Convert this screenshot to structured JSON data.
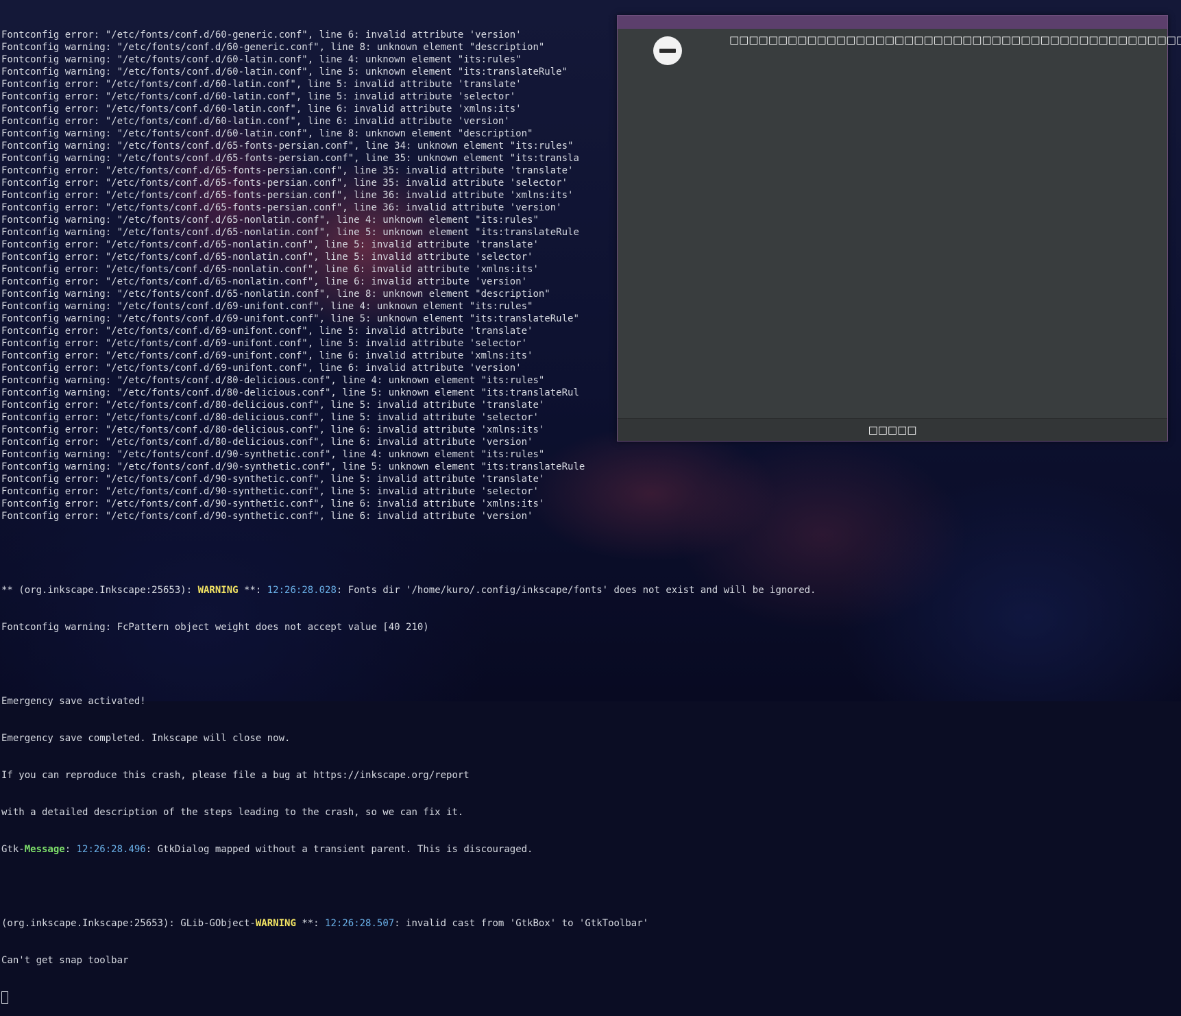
{
  "terminal": {
    "lines": [
      "Fontconfig error: \"/etc/fonts/conf.d/60-generic.conf\", line 6: invalid attribute 'version'",
      "Fontconfig warning: \"/etc/fonts/conf.d/60-generic.conf\", line 8: unknown element \"description\"",
      "Fontconfig warning: \"/etc/fonts/conf.d/60-latin.conf\", line 4: unknown element \"its:rules\"",
      "Fontconfig warning: \"/etc/fonts/conf.d/60-latin.conf\", line 5: unknown element \"its:translateRule\"",
      "Fontconfig error: \"/etc/fonts/conf.d/60-latin.conf\", line 5: invalid attribute 'translate'",
      "Fontconfig error: \"/etc/fonts/conf.d/60-latin.conf\", line 5: invalid attribute 'selector'",
      "Fontconfig error: \"/etc/fonts/conf.d/60-latin.conf\", line 6: invalid attribute 'xmlns:its'",
      "Fontconfig error: \"/etc/fonts/conf.d/60-latin.conf\", line 6: invalid attribute 'version'",
      "Fontconfig warning: \"/etc/fonts/conf.d/60-latin.conf\", line 8: unknown element \"description\"",
      "Fontconfig warning: \"/etc/fonts/conf.d/65-fonts-persian.conf\", line 34: unknown element \"its:rules\"",
      "Fontconfig warning: \"/etc/fonts/conf.d/65-fonts-persian.conf\", line 35: unknown element \"its:transla",
      "Fontconfig error: \"/etc/fonts/conf.d/65-fonts-persian.conf\", line 35: invalid attribute 'translate'",
      "Fontconfig error: \"/etc/fonts/conf.d/65-fonts-persian.conf\", line 35: invalid attribute 'selector'",
      "Fontconfig error: \"/etc/fonts/conf.d/65-fonts-persian.conf\", line 36: invalid attribute 'xmlns:its'",
      "Fontconfig error: \"/etc/fonts/conf.d/65-fonts-persian.conf\", line 36: invalid attribute 'version'",
      "Fontconfig warning: \"/etc/fonts/conf.d/65-nonlatin.conf\", line 4: unknown element \"its:rules\"",
      "Fontconfig warning: \"/etc/fonts/conf.d/65-nonlatin.conf\", line 5: unknown element \"its:translateRule",
      "Fontconfig error: \"/etc/fonts/conf.d/65-nonlatin.conf\", line 5: invalid attribute 'translate'",
      "Fontconfig error: \"/etc/fonts/conf.d/65-nonlatin.conf\", line 5: invalid attribute 'selector'",
      "Fontconfig error: \"/etc/fonts/conf.d/65-nonlatin.conf\", line 6: invalid attribute 'xmlns:its'",
      "Fontconfig error: \"/etc/fonts/conf.d/65-nonlatin.conf\", line 6: invalid attribute 'version'",
      "Fontconfig warning: \"/etc/fonts/conf.d/65-nonlatin.conf\", line 8: unknown element \"description\"",
      "Fontconfig warning: \"/etc/fonts/conf.d/69-unifont.conf\", line 4: unknown element \"its:rules\"",
      "Fontconfig warning: \"/etc/fonts/conf.d/69-unifont.conf\", line 5: unknown element \"its:translateRule\"",
      "Fontconfig error: \"/etc/fonts/conf.d/69-unifont.conf\", line 5: invalid attribute 'translate'",
      "Fontconfig error: \"/etc/fonts/conf.d/69-unifont.conf\", line 5: invalid attribute 'selector'",
      "Fontconfig error: \"/etc/fonts/conf.d/69-unifont.conf\", line 6: invalid attribute 'xmlns:its'",
      "Fontconfig error: \"/etc/fonts/conf.d/69-unifont.conf\", line 6: invalid attribute 'version'",
      "Fontconfig warning: \"/etc/fonts/conf.d/80-delicious.conf\", line 4: unknown element \"its:rules\"",
      "Fontconfig warning: \"/etc/fonts/conf.d/80-delicious.conf\", line 5: unknown element \"its:translateRul",
      "Fontconfig error: \"/etc/fonts/conf.d/80-delicious.conf\", line 5: invalid attribute 'translate'",
      "Fontconfig error: \"/etc/fonts/conf.d/80-delicious.conf\", line 5: invalid attribute 'selector'",
      "Fontconfig error: \"/etc/fonts/conf.d/80-delicious.conf\", line 6: invalid attribute 'xmlns:its'",
      "Fontconfig error: \"/etc/fonts/conf.d/80-delicious.conf\", line 6: invalid attribute 'version'",
      "Fontconfig warning: \"/etc/fonts/conf.d/90-synthetic.conf\", line 4: unknown element \"its:rules\"",
      "Fontconfig warning: \"/etc/fonts/conf.d/90-synthetic.conf\", line 5: unknown element \"its:translateRule",
      "Fontconfig error: \"/etc/fonts/conf.d/90-synthetic.conf\", line 5: invalid attribute 'translate'",
      "Fontconfig error: \"/etc/fonts/conf.d/90-synthetic.conf\", line 5: invalid attribute 'selector'",
      "Fontconfig error: \"/etc/fonts/conf.d/90-synthetic.conf\", line 6: invalid attribute 'xmlns:its'",
      "Fontconfig error: \"/etc/fonts/conf.d/90-synthetic.conf\", line 6: invalid attribute 'version'"
    ],
    "inkscape_warning": {
      "prefix": "** (org.inkscape.Inkscape:25653): ",
      "level": "WARNING",
      "mid": " **: ",
      "time": "12:26:28.028",
      "text": ": Fonts dir '/home/kuro/.config/inkscape/fonts' does not exist and will be ignored."
    },
    "pattern_warning": "Fontconfig warning: FcPattern object weight does not accept value [40 210)",
    "emergency_lines": [
      "Emergency save activated!",
      "Emergency save completed. Inkscape will close now.",
      "If you can reproduce this crash, please file a bug at https://inkscape.org/report",
      "with a detailed description of the steps leading to the crash, so we can fix it."
    ],
    "gtk_message": {
      "prefix": "Gtk-",
      "level": "Message",
      "sep": ": ",
      "time": "12:26:28.496",
      "text": ": GtkDialog mapped without a transient parent. This is discouraged."
    },
    "glib_warning": {
      "prefix": "(org.inkscape.Inkscape:25653): GLib-GObject-",
      "level": "WARNING",
      "mid": " **: ",
      "time": "12:26:28.507",
      "text": ": invalid cast from 'GtkBox' to 'GtkToolbar'"
    },
    "last_line": "Can't get snap toolbar"
  },
  "dialog": {
    "message": "□□□□□□□□□□□□□□□□□□□□□□□□□□□□□□□□□□□□□□□□□□□□□□□□□□□□",
    "close_button": "□□□□□",
    "icon": "minus-circle-icon"
  },
  "colors": {
    "warning": "#f3e463",
    "message": "#7ee06a",
    "timestamp": "#6ab0e8",
    "dialog_bg": "#393d3e",
    "dialog_titlebar": "#5c3f6c"
  }
}
